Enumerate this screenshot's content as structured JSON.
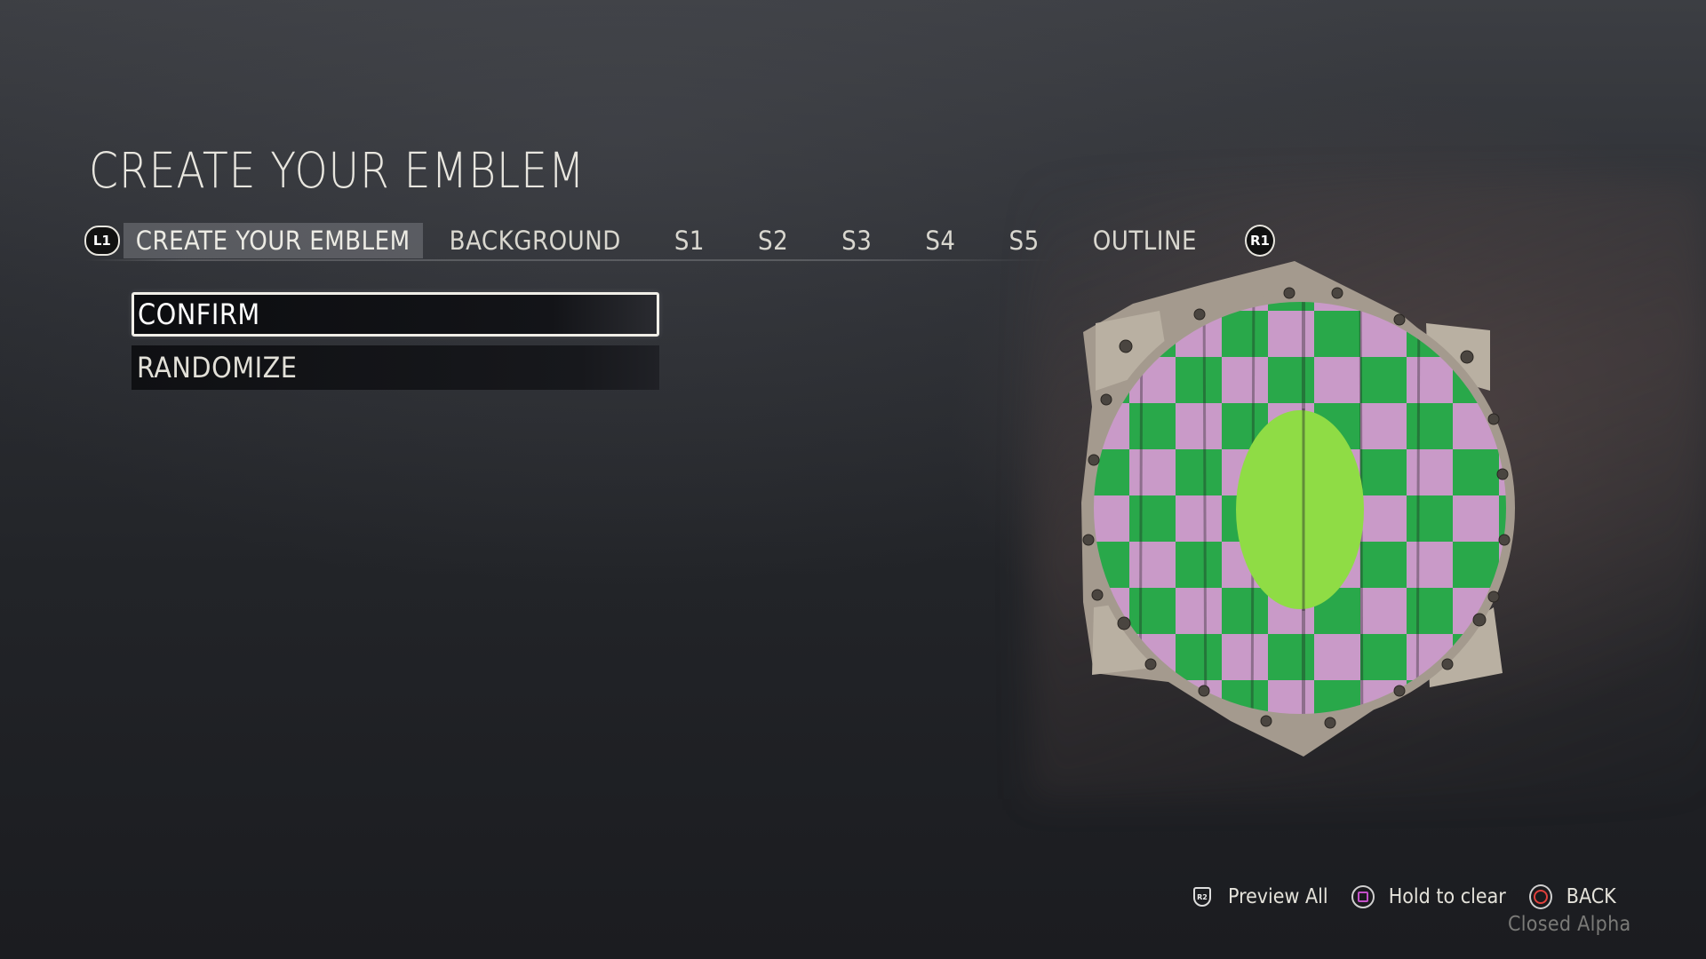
{
  "page": {
    "title": "CREATE YOUR EMBLEM"
  },
  "tabs": {
    "prev_button": "L1",
    "next_button": "R1",
    "items": [
      {
        "label": "CREATE YOUR EMBLEM",
        "active": true
      },
      {
        "label": "BACKGROUND",
        "active": false
      },
      {
        "label": "S1",
        "active": false
      },
      {
        "label": "S2",
        "active": false
      },
      {
        "label": "S3",
        "active": false
      },
      {
        "label": "S4",
        "active": false
      },
      {
        "label": "S5",
        "active": false
      },
      {
        "label": "OUTLINE",
        "active": false
      }
    ]
  },
  "menu": {
    "confirm_label": "CONFIRM",
    "randomize_label": "RANDOMIZE"
  },
  "emblem": {
    "pattern": "checkerboard",
    "color_a": "#29a84a",
    "color_b": "#c99ac8",
    "center_shape": "ellipse",
    "center_color": "#8fdc45",
    "frame_color": "#a49a8e"
  },
  "footer": {
    "preview_glyph": "R2",
    "preview_label": "Preview All",
    "clear_label": "Hold to clear",
    "back_label": "BACK"
  },
  "watermark": "Closed Alpha"
}
